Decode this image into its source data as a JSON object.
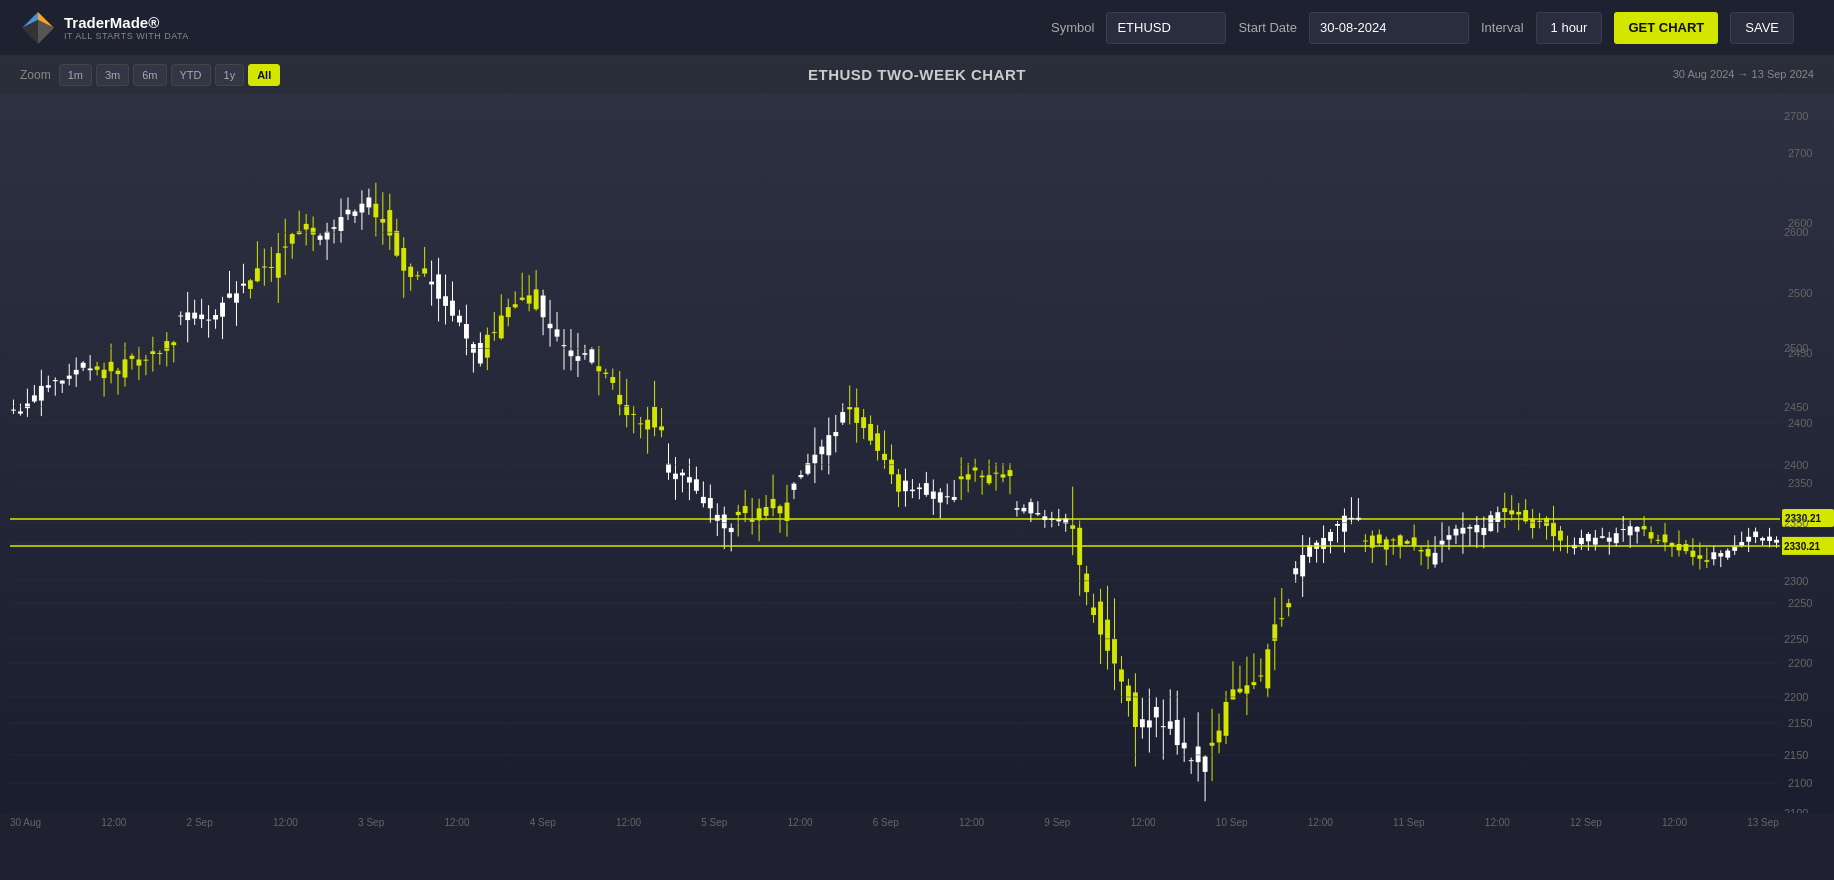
{
  "header": {
    "logo_name": "TraderMade®",
    "logo_tagline": "IT ALL STARTS WITH DATA",
    "symbol_label": "Symbol",
    "symbol_value": "ETHUSD",
    "start_date_label": "Start Date",
    "start_date_value": "30-08-2024",
    "interval_label": "Interval",
    "interval_value": "1 hour",
    "get_chart_label": "GET CHART",
    "save_label": "SAVE"
  },
  "chart": {
    "title": "ETHUSD TWO-WEEK CHART",
    "zoom_label": "Zoom",
    "zoom_buttons": [
      "1m",
      "3m",
      "6m",
      "YTD",
      "1y",
      "All"
    ],
    "active_zoom": "All",
    "date_range": "30 Aug 2024  →  13 Sep 2024",
    "current_price": "2330.21",
    "price_levels": [
      "2700",
      "2600",
      "2500",
      "2450",
      "2400",
      "2350",
      "2300",
      "2250",
      "2200",
      "2150",
      "2100"
    ],
    "x_labels": [
      "30 Aug",
      "12:00",
      "2 Sep",
      "12:00",
      "3 Sep",
      "12:00",
      "4 Sep",
      "12:00",
      "5 Sep",
      "12:00",
      "6 Sep",
      "12:00",
      "9 Sep",
      "12:00",
      "10 Sep",
      "12:00",
      "11 Sep",
      "12:00",
      "12 Sep",
      "12:00",
      "13 Sep"
    ]
  }
}
